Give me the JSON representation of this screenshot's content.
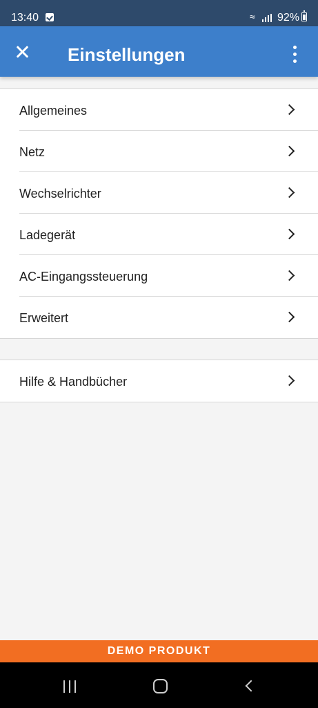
{
  "status_bar": {
    "time": "13:40",
    "battery": "92%",
    "icons": [
      "notification-check-icon",
      "wifi-icon",
      "signal-icon",
      "battery-icon"
    ]
  },
  "app_bar": {
    "title": "Einstellungen",
    "close_icon": "close-icon",
    "menu_icon": "more-vert-icon",
    "background": "#3d7fcb"
  },
  "settings": {
    "items": [
      {
        "label": "Allgemeines"
      },
      {
        "label": "Netz"
      },
      {
        "label": "Wechselrichter"
      },
      {
        "label": "Ladegerät"
      },
      {
        "label": "AC-Eingangssteuerung"
      },
      {
        "label": "Erweitert"
      }
    ]
  },
  "help": {
    "items": [
      {
        "label": "Hilfe & Handbücher"
      }
    ]
  },
  "demo_banner": {
    "text": "DEMO PRODUKT",
    "color": "#f26e22"
  },
  "nav_bar": {
    "icons": [
      "recents-icon",
      "home-icon",
      "back-icon"
    ]
  }
}
